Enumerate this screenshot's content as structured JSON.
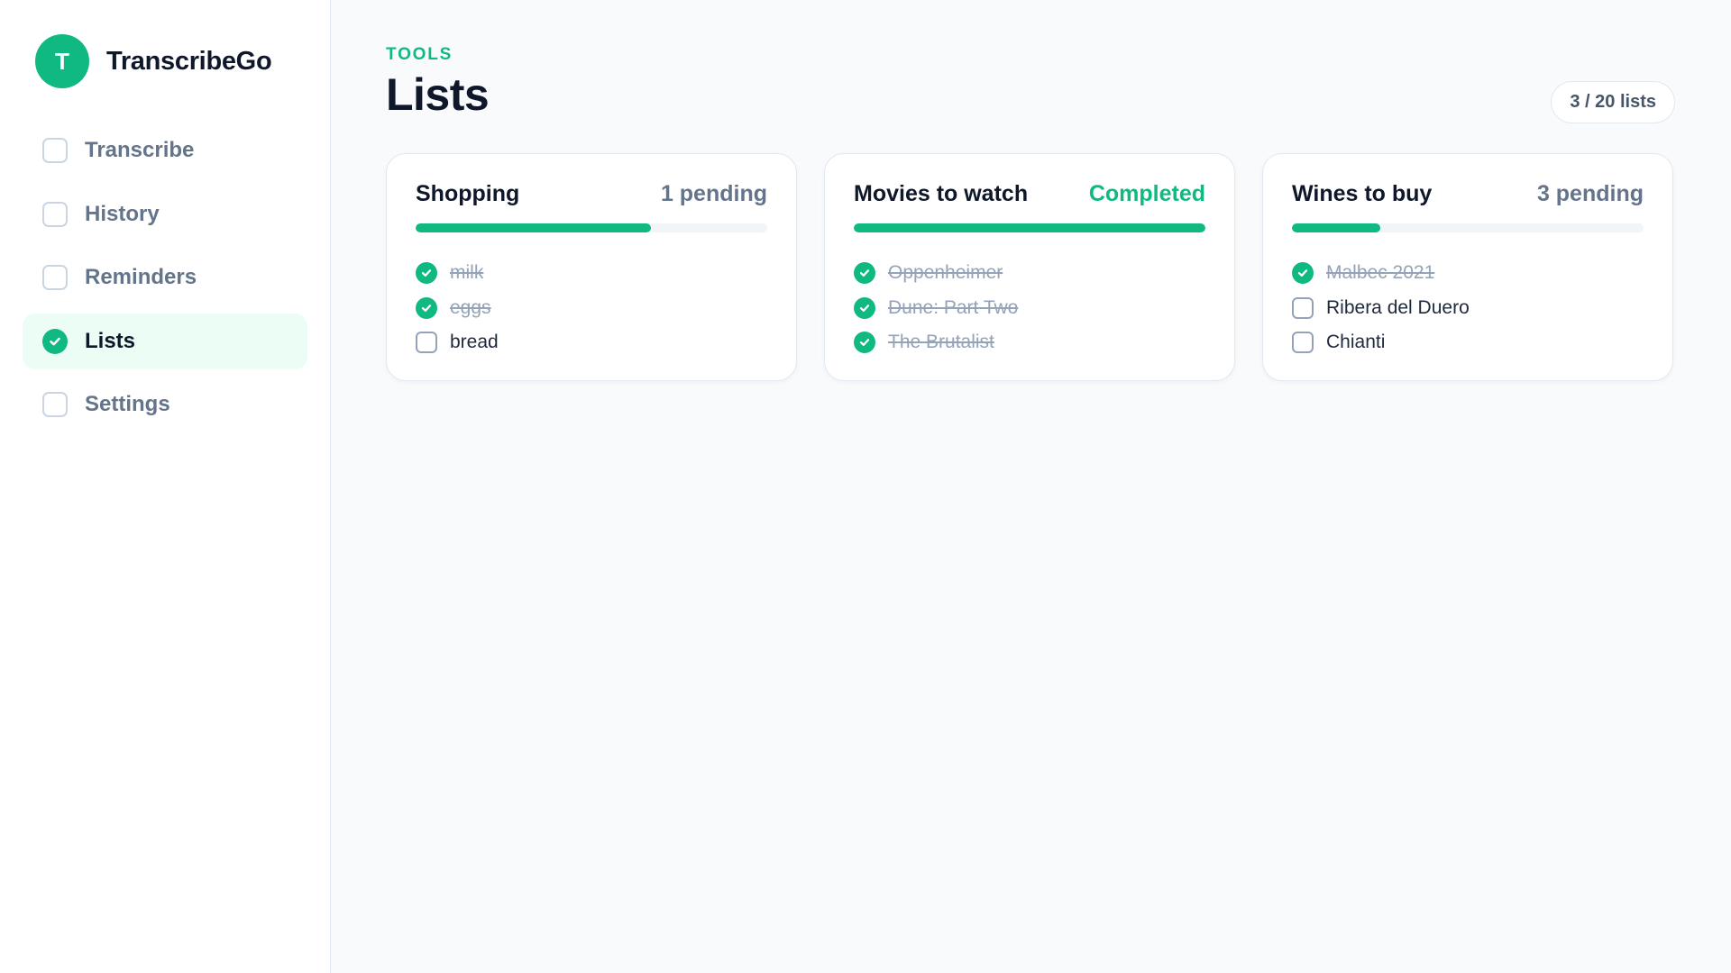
{
  "brand": {
    "logo_letter": "T",
    "name": "TranscribeGo"
  },
  "nav": [
    {
      "label": "Transcribe",
      "active": false
    },
    {
      "label": "History",
      "active": false
    },
    {
      "label": "Reminders",
      "active": false
    },
    {
      "label": "Lists",
      "active": true
    },
    {
      "label": "Settings",
      "active": false
    }
  ],
  "header": {
    "eyebrow": "TOOLS",
    "title": "Lists",
    "count_badge": "3 / 20 lists"
  },
  "lists": [
    {
      "title": "Shopping",
      "status": "1 pending",
      "completed": false,
      "progress_percent": 67,
      "items": [
        {
          "text": "milk",
          "done": true
        },
        {
          "text": "eggs",
          "done": true
        },
        {
          "text": "bread",
          "done": false
        }
      ]
    },
    {
      "title": "Movies to watch",
      "status": "Completed",
      "completed": true,
      "progress_percent": 100,
      "items": [
        {
          "text": "Oppenheimer",
          "done": true
        },
        {
          "text": "Dune: Part Two",
          "done": true
        },
        {
          "text": "The Brutalist",
          "done": true
        }
      ]
    },
    {
      "title": "Wines to buy",
      "status": "3 pending",
      "completed": false,
      "progress_percent": 25,
      "items": [
        {
          "text": "Malbec 2021",
          "done": true
        },
        {
          "text": "Ribera del Duero",
          "done": false
        },
        {
          "text": "Chianti",
          "done": false
        }
      ]
    }
  ],
  "colors": {
    "accent": "#10b981",
    "accent_bg": "#ecfdf5",
    "muted": "#94a3b8"
  }
}
